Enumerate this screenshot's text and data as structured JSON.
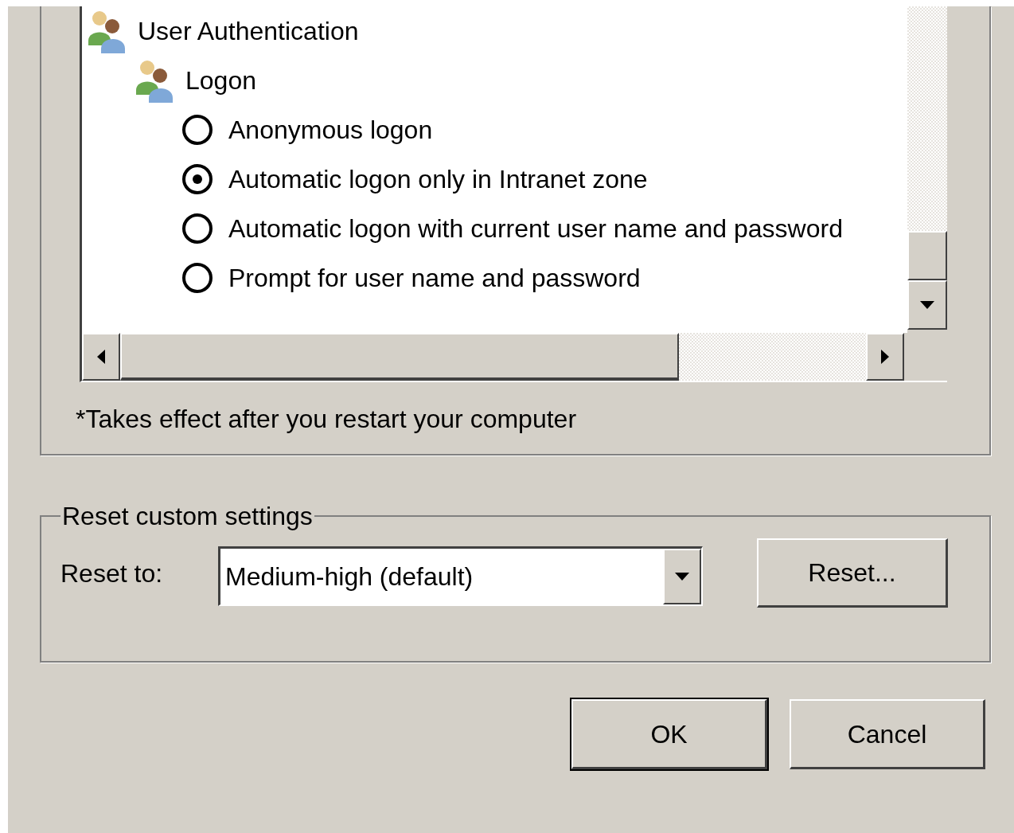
{
  "tree": [
    {
      "kind": "group",
      "label": "User Authentication",
      "children": [
        {
          "kind": "group",
          "label": "Logon",
          "children": [
            {
              "kind": "radio",
              "label": "Anonymous logon",
              "selected": false
            },
            {
              "kind": "radio",
              "label": "Automatic logon only in Intranet zone",
              "selected": true
            },
            {
              "kind": "radio",
              "label": "Automatic logon with current user name and password",
              "selected": false
            },
            {
              "kind": "radio",
              "label": "Prompt for user name and password",
              "selected": false
            }
          ]
        }
      ]
    }
  ],
  "note": "*Takes effect after you restart your computer",
  "reset_group": {
    "title": "Reset custom settings",
    "label": "Reset to:",
    "dropdown": {
      "value": "Medium-high (default)"
    },
    "button": "Reset..."
  },
  "buttons": [
    {
      "label": "OK",
      "default": true
    },
    {
      "label": "Cancel",
      "default": false
    }
  ]
}
